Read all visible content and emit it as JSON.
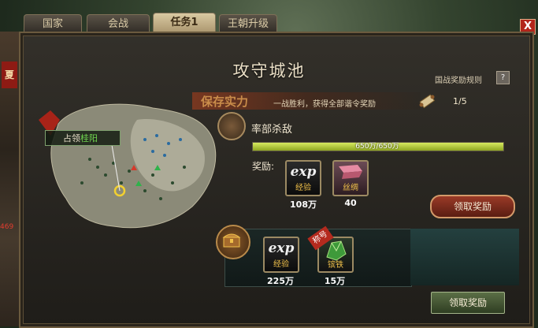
{
  "tabs": [
    "国家",
    "会战",
    "任务1",
    "王朝升级"
  ],
  "close_label": "X",
  "left_strip": {
    "flag_text": "夏",
    "number": "469"
  },
  "title": "攻守城池",
  "rules_link": "国战奖励规则",
  "help": "?",
  "banner": {
    "big": "保存实力",
    "small": "一战胜利，获得全部谐令奖励",
    "progress": "1/5"
  },
  "map": {
    "occupy_label": "占领",
    "occupy_city": "桂阳"
  },
  "task": {
    "name": "率部杀敌",
    "progress_text": "650万/650万",
    "progress_fraction": 1.0,
    "reward_label": "奖励:",
    "rewards": [
      {
        "icon": "exp-icon",
        "word": "exp",
        "sub": "经验",
        "qty": "108万"
      },
      {
        "icon": "silk-icon",
        "sub": "丝绸",
        "qty": "40"
      }
    ],
    "claim": "领取奖励"
  },
  "chest": {
    "rewards": [
      {
        "icon": "exp-icon",
        "word": "exp",
        "sub": "经验",
        "qty": "225万"
      },
      {
        "icon": "iron-icon",
        "sub": "镔铁",
        "qty": "15万",
        "badge": "称号"
      }
    ],
    "claim": "领取奖励"
  },
  "colors": {
    "accent_red": "#b3251b",
    "progress_green": "#b6d03f",
    "gold": "#f0c04a"
  }
}
